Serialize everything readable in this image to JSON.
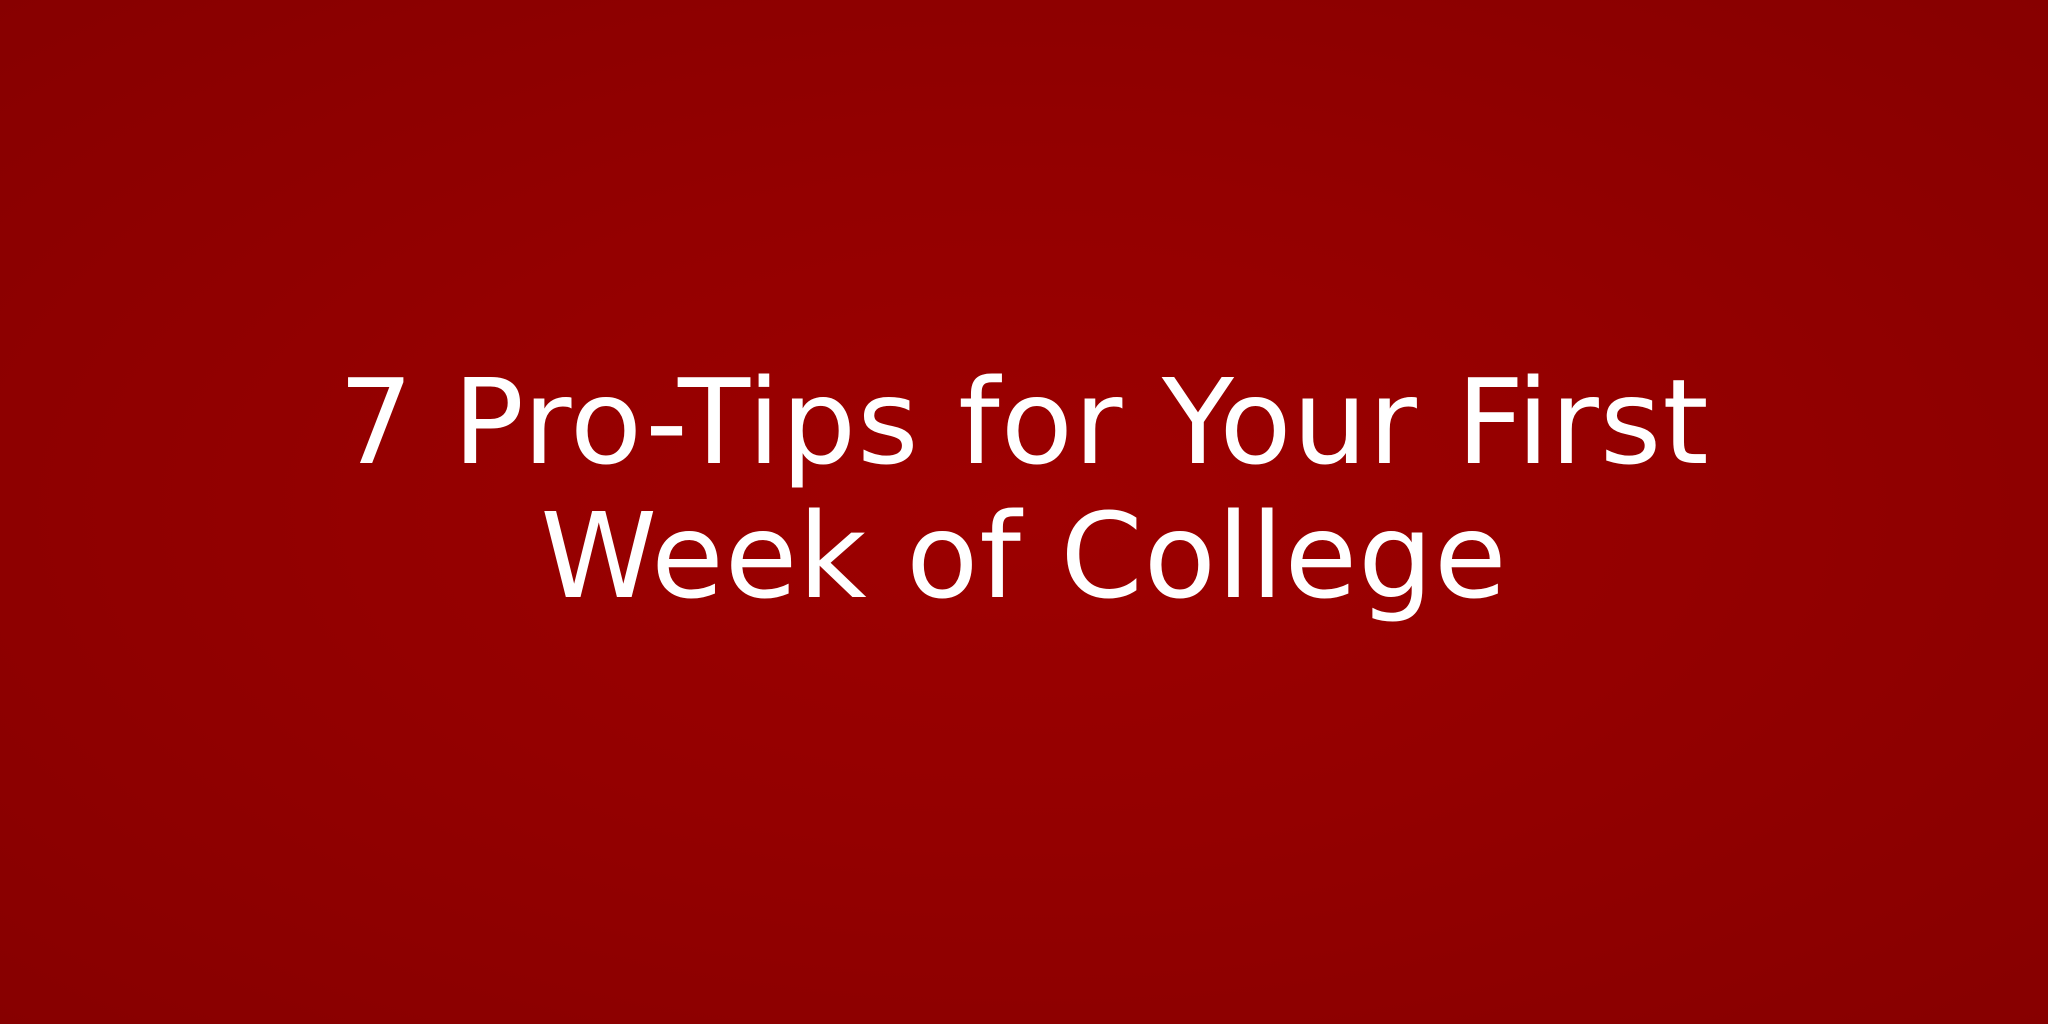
{
  "banner": {
    "background_color": "#940000",
    "text_color": "#ffffff",
    "title_lines": [
      "7 Pro-Tips for Your First",
      "Week of College"
    ]
  }
}
